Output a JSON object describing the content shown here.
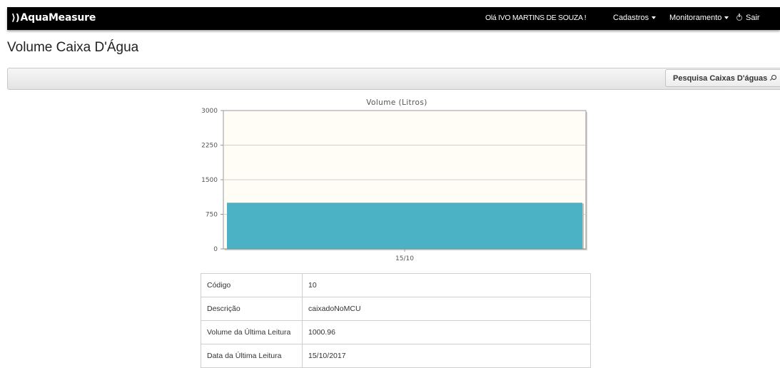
{
  "header": {
    "brand": "AquaMeasure",
    "greeting": "Olá IVO MARTINS DE SOUZA !",
    "menu": {
      "cadastros": "Cadastros",
      "monitoramento": "Monitoramento",
      "sair": "Sair"
    }
  },
  "page": {
    "title": "Volume Caixa D'Água"
  },
  "toolbar": {
    "search_label": "Pesquisa Caixas D'águas"
  },
  "chart_data": {
    "type": "bar",
    "title": "Volume (Litros)",
    "categories": [
      "15/10"
    ],
    "values": [
      1000.96
    ],
    "ylim": [
      0,
      3000
    ],
    "yticks": [
      0,
      750,
      1500,
      2250,
      3000
    ],
    "grid": true,
    "colors": {
      "bar": "#4bb2c5",
      "plot_background": "#fffdf6"
    }
  },
  "details": {
    "rows": [
      {
        "label": "Código",
        "value": "10"
      },
      {
        "label": "Descrição",
        "value": "caixadoNoMCU"
      },
      {
        "label": "Volume da Última Leitura",
        "value": "1000.96"
      },
      {
        "label": "Data da Última Leitura",
        "value": "15/10/2017"
      }
    ]
  }
}
